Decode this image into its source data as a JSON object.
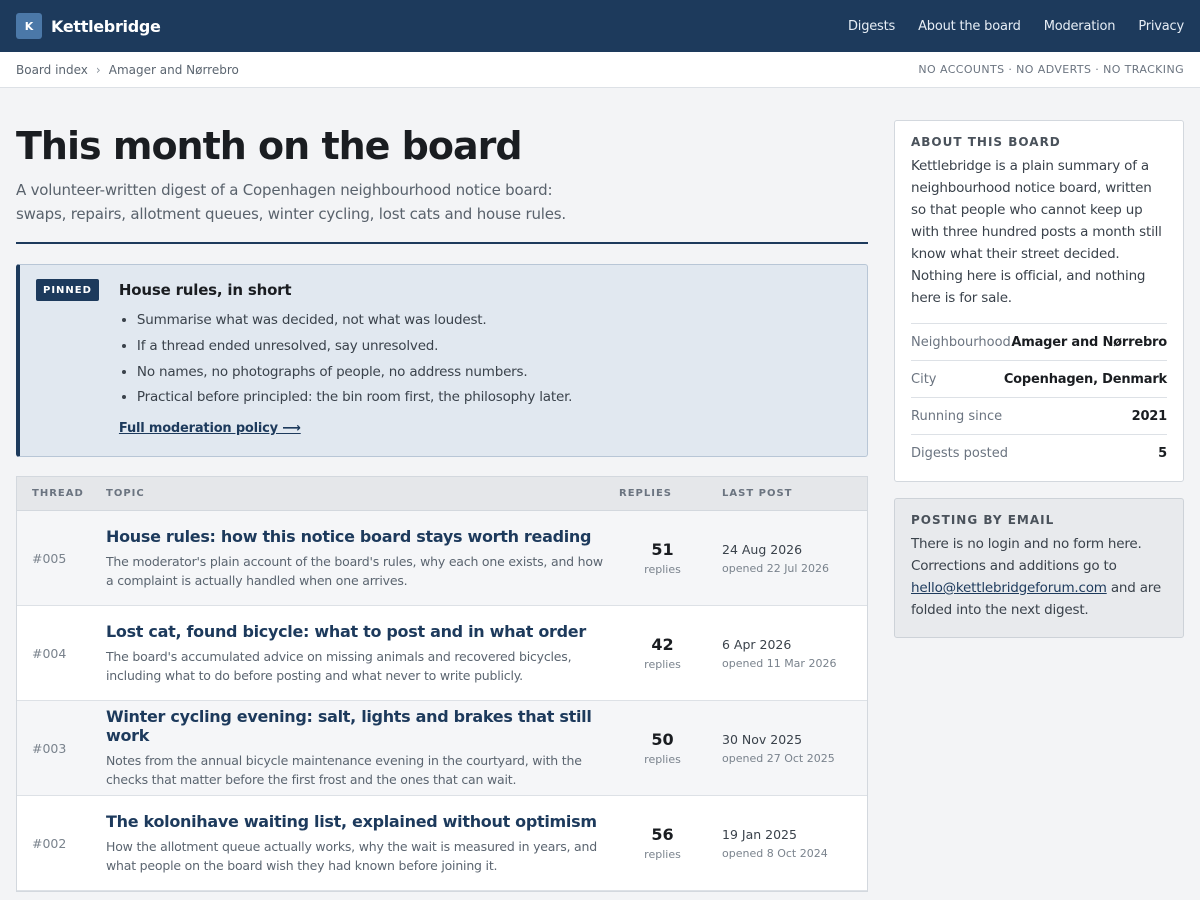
{
  "header": {
    "logo_letter": "K",
    "brand": "Kettlebridge",
    "nav": [
      "Digests",
      "About the board",
      "Moderation",
      "Privacy"
    ]
  },
  "breadcrumb": {
    "items": [
      "Board index",
      "Amager and Nørrebro"
    ],
    "separator": "›",
    "tagline": "NO ACCOUNTS · NO ADVERTS · NO TRACKING"
  },
  "main": {
    "title": "This month on the board",
    "lede": "A volunteer-written digest of a Copenhagen neighbourhood notice board: swaps, repairs, allotment queues, winter cycling, lost cats and house rules."
  },
  "pinned": {
    "badge": "PINNED",
    "title": "House rules, in short",
    "rules": [
      "Summarise what was decided, not what was loudest.",
      "If a thread ended unresolved, say unresolved.",
      "No names, no photographs of people, no address numbers.",
      "Practical before principled: the bin room first, the philosophy later."
    ],
    "link": "Full moderation policy ⟶"
  },
  "table": {
    "headers": {
      "thread": "THREAD",
      "topic": "TOPIC",
      "replies": "REPLIES",
      "last": "LAST POST"
    },
    "reply_label": "replies",
    "rows": [
      {
        "id": "#005",
        "title": "House rules: how this notice board stays worth reading",
        "desc": "The moderator's plain account of the board's rules, why each one exists, and how a complaint is actually handled when one arrives.",
        "replies": "51",
        "last": "24 Aug 2026",
        "opened": "opened 22 Jul 2026"
      },
      {
        "id": "#004",
        "title": "Lost cat, found bicycle: what to post and in what order",
        "desc": "The board's accumulated advice on missing animals and recovered bicycles, including what to do before posting and what never to write publicly.",
        "replies": "42",
        "last": "6 Apr 2026",
        "opened": "opened 11 Mar 2026"
      },
      {
        "id": "#003",
        "title": "Winter cycling evening: salt, lights and brakes that still work",
        "desc": "Notes from the annual bicycle maintenance evening in the courtyard, with the checks that matter before the first frost and the ones that can wait.",
        "replies": "50",
        "last": "30 Nov 2025",
        "opened": "opened 27 Oct 2025"
      },
      {
        "id": "#002",
        "title": "The kolonihave waiting list, explained without optimism",
        "desc": "How the allotment queue actually works, why the wait is measured in years, and what people on the board wish they had known before joining it.",
        "replies": "56",
        "last": "19 Jan 2025",
        "opened": "opened 8 Oct 2024"
      }
    ]
  },
  "aside": {
    "about_heading": "ABOUT THIS BOARD",
    "about_text": "Kettlebridge is a plain summary of a neighbourhood notice board, written so that people who cannot keep up with three hundred posts a month still know what their street decided. Nothing here is official, and nothing here is for sale.",
    "facts": [
      {
        "k": "Neighbourhood",
        "v": "Amager and Nørrebro"
      },
      {
        "k": "City",
        "v": "Copenhagen, Denmark"
      },
      {
        "k": "Running since",
        "v": "2021"
      },
      {
        "k": "Digests posted",
        "v": "5"
      }
    ],
    "email_heading": "POSTING BY EMAIL",
    "email_text_before": "There is no login and no form here. Corrections and additions go to",
    "email_address": "hello@kettlebridgeforum.com",
    "email_text_after": "and are folded into the next digest."
  },
  "colors": {
    "brand_navy": "#1d3a5c",
    "pinned_bg": "#e1e8f0",
    "page_bg": "#f3f4f6"
  }
}
